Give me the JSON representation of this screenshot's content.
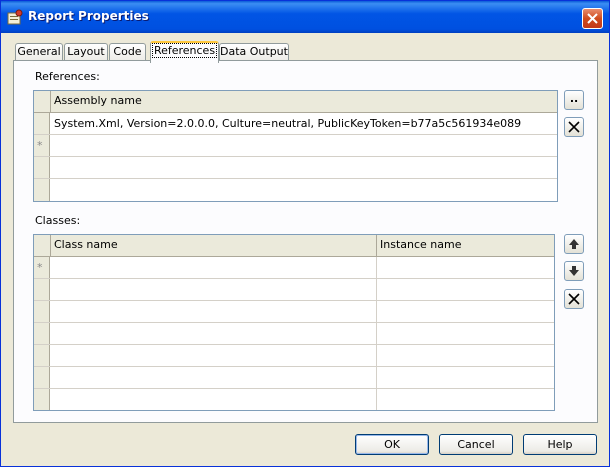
{
  "window": {
    "title": "Report Properties"
  },
  "tabs": [
    {
      "label": "General"
    },
    {
      "label": "Layout"
    },
    {
      "label": "Code"
    },
    {
      "label": "References",
      "active": true
    },
    {
      "label": "Data Output"
    }
  ],
  "references": {
    "label": "References:",
    "column": "Assembly name",
    "rows": [
      "System.Xml, Version=2.0.0.0, Culture=neutral, PublicKeyToken=b77a5c561934e089"
    ],
    "new_row_marker": "*",
    "browse_button": ".."
  },
  "classes": {
    "label": "Classes:",
    "columns": [
      "Class name",
      "Instance name"
    ],
    "new_row_marker": "*"
  },
  "buttons": {
    "ok": "OK",
    "cancel": "Cancel",
    "help": "Help"
  },
  "colors": {
    "titlebar": "#0155e5",
    "active_tab_accent": "#ffc83c",
    "dialog_bg": "#ece9d8"
  }
}
